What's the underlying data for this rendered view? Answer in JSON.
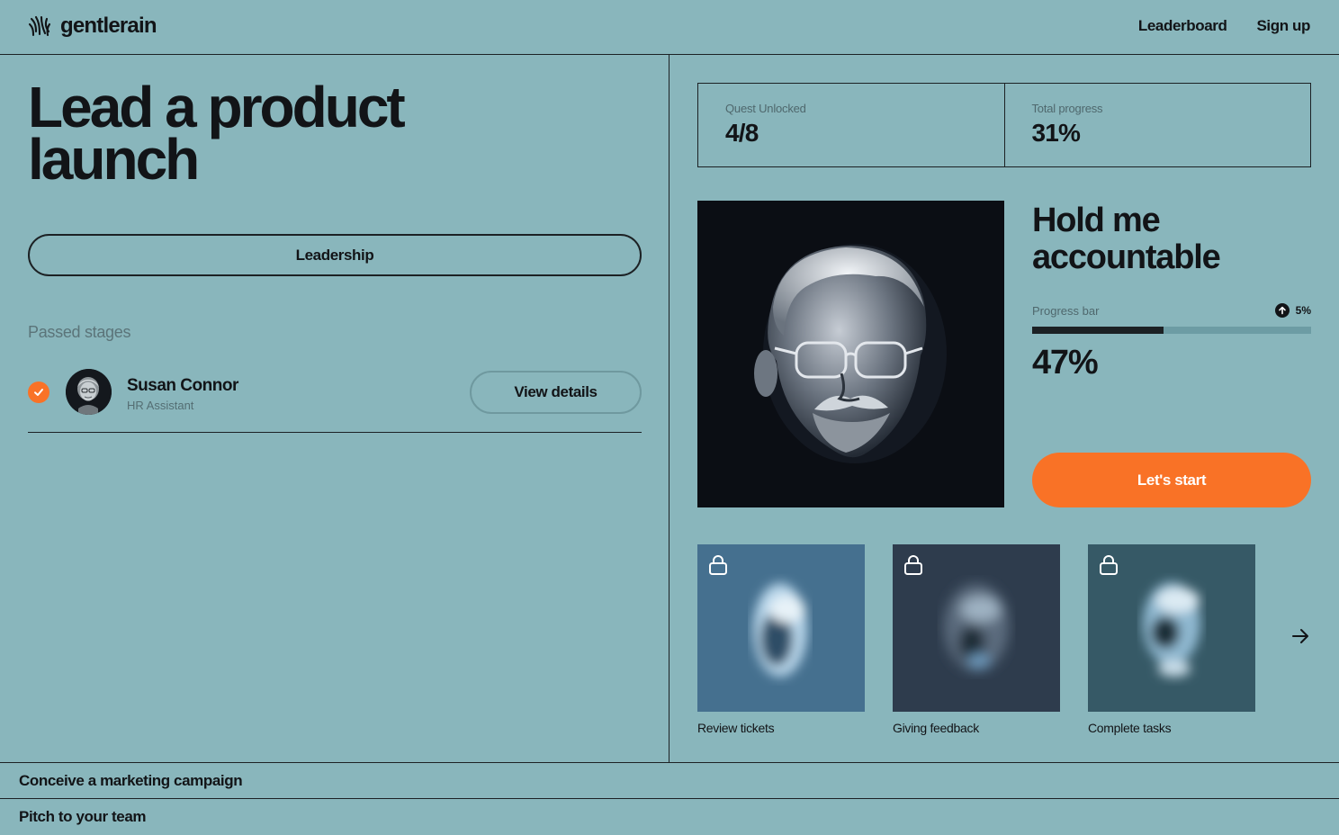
{
  "header": {
    "logo_text": "gentlerain",
    "nav": [
      "Leaderboard",
      "Sign up"
    ]
  },
  "quest": {
    "title": "Lead a product launch",
    "category": "Leadership",
    "passed_stages_label": "Passed stages",
    "passed_stages": [
      {
        "name": "Susan Connor",
        "role": "HR Assistant",
        "action": "View details",
        "completed": true
      }
    ]
  },
  "stats": {
    "quest_unlocked_label": "Quest Unlocked",
    "quest_unlocked_value": "4/8",
    "total_progress_label": "Total progress",
    "total_progress_value": "31%"
  },
  "current_stage": {
    "title": "Hold me accountable",
    "progress_label": "Progress bar",
    "progress_delta": "5%",
    "progress_value": "47%",
    "progress_fraction": 0.47,
    "cta": "Let's start"
  },
  "locked_stages": [
    {
      "caption": "Review tickets",
      "color": "#45708f"
    },
    {
      "caption": "Giving feedback",
      "color": "#2e3c4d"
    },
    {
      "caption": "Complete tasks",
      "color": "#365966"
    }
  ],
  "other_quests": [
    "Conceive a marketing campaign",
    "Pitch to your team"
  ],
  "colors": {
    "background": "#89b6bc",
    "accent": "#f97226",
    "ink": "#121417"
  }
}
